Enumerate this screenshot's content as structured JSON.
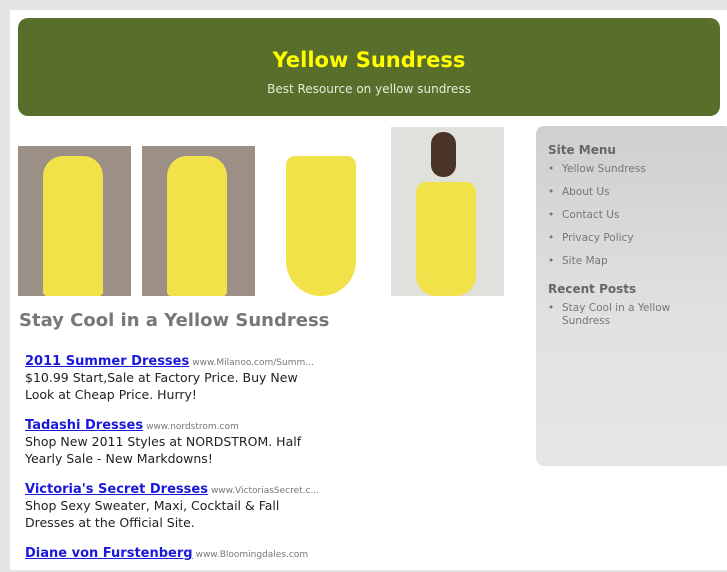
{
  "header": {
    "title": "Yellow Sundress",
    "tagline": "Best Resource on yellow sundress"
  },
  "post": {
    "title": "Stay Cool in a Yellow Sundress"
  },
  "ads": [
    {
      "title": "2011 Summer Dresses",
      "url": "www.Milanoo.com/Summ...",
      "text": "$10.99 Start,Sale at Factory Price. Buy New Look at Cheap Price. Hurry!"
    },
    {
      "title": "Tadashi Dresses",
      "url": "www.nordstrom.com",
      "text": "Shop New 2011 Styles at NORDSTROM. Half Yearly Sale - New Markdowns!"
    },
    {
      "title": "Victoria's Secret Dresses",
      "url": "www.VictoriasSecret.c...",
      "text": "Shop Sexy Sweater, Maxi, Cocktail & Fall Dresses at the Official Site."
    },
    {
      "title": "Diane von Furstenberg",
      "url": "www.Bloomingdales.com",
      "text": ""
    }
  ],
  "sidebar": {
    "menu_title": "Site Menu",
    "menu": [
      "Yellow Sundress",
      "About Us",
      "Contact Us",
      "Privacy Policy",
      "Site Map"
    ],
    "recent_title": "Recent Posts",
    "recent": [
      "Stay Cool in a Yellow Sundress"
    ]
  }
}
